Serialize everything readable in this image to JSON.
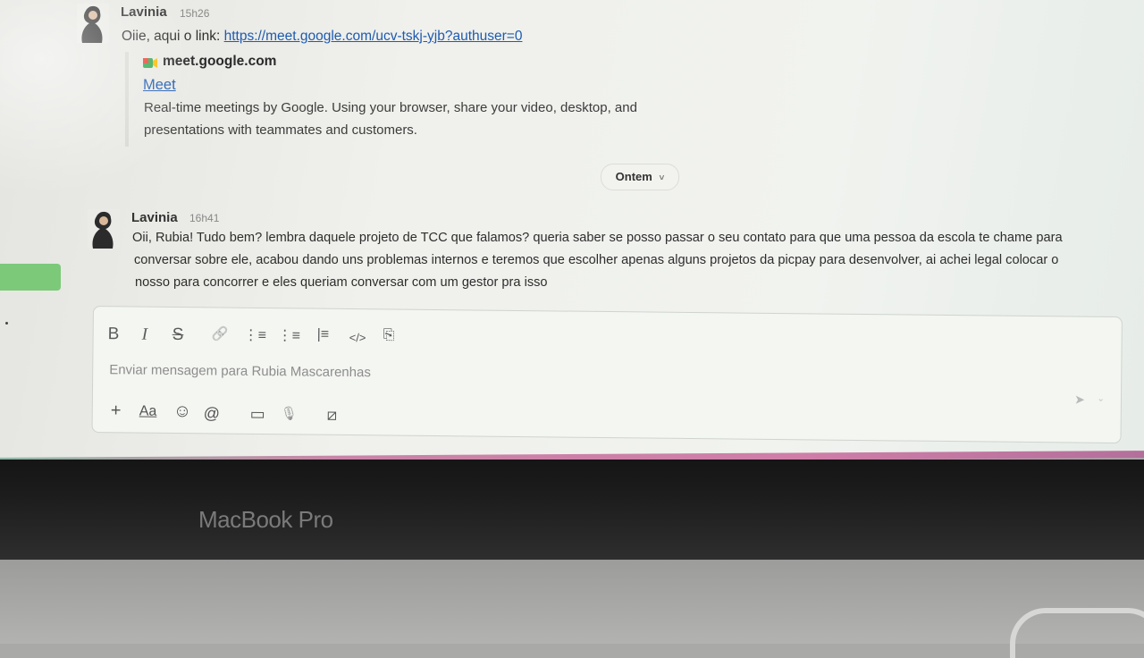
{
  "messages": [
    {
      "sender": "Lavinia",
      "time": "15h26",
      "text_prefix": "Oiie, aqui o link: ",
      "link": "https://meet.google.com/ucv-tskj-yjb?authuser=0",
      "preview": {
        "site": "meet.google.com",
        "title": "Meet",
        "desc_line1": "Real-time meetings by Google. Using your browser, share your video, desktop, and",
        "desc_line2": "presentations with teammates and customers."
      }
    },
    {
      "sender": "Lavinia",
      "time": "16h41",
      "line1": "Oii, Rubia! Tudo bem? lembra daquele projeto de TCC que falamos? queria saber se posso passar o seu contato para que uma pessoa da escola te chame para",
      "line2": "conversar sobre ele, acabou dando uns problemas internos e teremos que escolher apenas alguns projetos da picpay para desenvolver, ai achei legal colocar o",
      "line3": "nosso para concorrer e eles queriam conversar com um gestor pra isso"
    }
  ],
  "divider": {
    "label": "Ontem",
    "caret": "˅"
  },
  "composer": {
    "placeholder": "Enviar mensagem para Rubia Mascarenhas",
    "toolbar": {
      "bold": "B",
      "italic": "I",
      "strike": "S",
      "link": "🔗",
      "ordered_list": "⋮≡",
      "bullet_list": "⋮≡",
      "blockquote": "|≡",
      "code": "</>",
      "code_block": "⎘"
    },
    "bottom": {
      "plus": "+",
      "format": "Aa",
      "emoji": "☺",
      "mention": "@",
      "video": "▭",
      "mic": "🎙",
      "shortcut": "⧄"
    },
    "send": "➤",
    "send_caret": "⌄"
  },
  "device": {
    "label": "MacBook Pro"
  },
  "colors": {
    "link": "#1d5bb0",
    "pink_edge": "#cf7ea8",
    "green_tab": "#7cc97a"
  }
}
